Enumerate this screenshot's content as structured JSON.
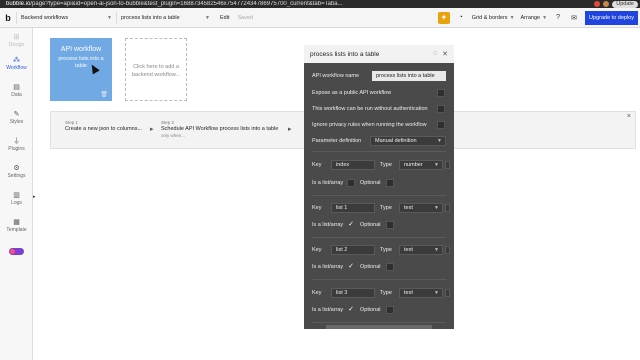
{
  "browser": {
    "url_domain": "bubble.io",
    "url_path": "/page?type=api&id=open-ai-json-to-bubble&test_plugin=1688734582546x754772434786975700_current&tab=Taba...",
    "update_label": "Update"
  },
  "toolbar": {
    "logo": "b",
    "page_select": "Backend workflows",
    "workflow_select": "process lists into a table",
    "edit_label": "Edit",
    "saved_label": "Saved",
    "grid_label": "Grid & borders",
    "arrange_label": "Arrange",
    "upgrade_label": "Upgrade to deploy"
  },
  "sidebar": {
    "items": [
      {
        "label": "Design",
        "icon": "design-icon"
      },
      {
        "label": "Workflow",
        "icon": "workflow-icon"
      },
      {
        "label": "Data",
        "icon": "data-icon"
      },
      {
        "label": "Styles",
        "icon": "styles-icon"
      },
      {
        "label": "Plugins",
        "icon": "plugins-icon"
      },
      {
        "label": "Settings",
        "icon": "settings-icon"
      },
      {
        "label": "Logs",
        "icon": "logs-icon"
      },
      {
        "label": "Template",
        "icon": "template-icon"
      }
    ]
  },
  "canvas": {
    "api_box": {
      "title": "API workflow",
      "subtitle": "process lists into a table"
    },
    "add_box": {
      "text": "Click here to add a backend workflow..."
    },
    "steps": [
      {
        "num": "Step 1",
        "name": "Create a new json to columns...",
        "cond": ""
      },
      {
        "num": "Step 2",
        "name": "Schedule API Workflow process lists into a table",
        "cond": "only when..."
      }
    ]
  },
  "panel": {
    "title": "process lists into a table",
    "name_label": "API workflow name",
    "name_value": "process lists into a table",
    "expose_label": "Expose as a public API workflow",
    "no_auth_label": "This workflow can be run without authentication",
    "ignore_privacy_label": "Ignore privacy rules when running the workflow",
    "param_def_label": "Parameter definition",
    "param_def_value": "Manual definition",
    "key_label": "Key",
    "type_label": "Type",
    "is_list_label": "Is a list/array",
    "optional_label": "Optional",
    "params": [
      {
        "key": "index",
        "type": "number",
        "is_list": false,
        "optional": false
      },
      {
        "key": "list 1",
        "type": "text",
        "is_list": true,
        "optional": false
      },
      {
        "key": "list 2",
        "type": "text",
        "is_list": true,
        "optional": false
      },
      {
        "key": "list 3",
        "type": "text",
        "is_list": true,
        "optional": false
      }
    ]
  },
  "colors": {
    "accent": "#2a5bd7",
    "api_box": "#70a9e3",
    "panel_bg": "#4a4a4a",
    "upgrade": "#2044e0"
  }
}
